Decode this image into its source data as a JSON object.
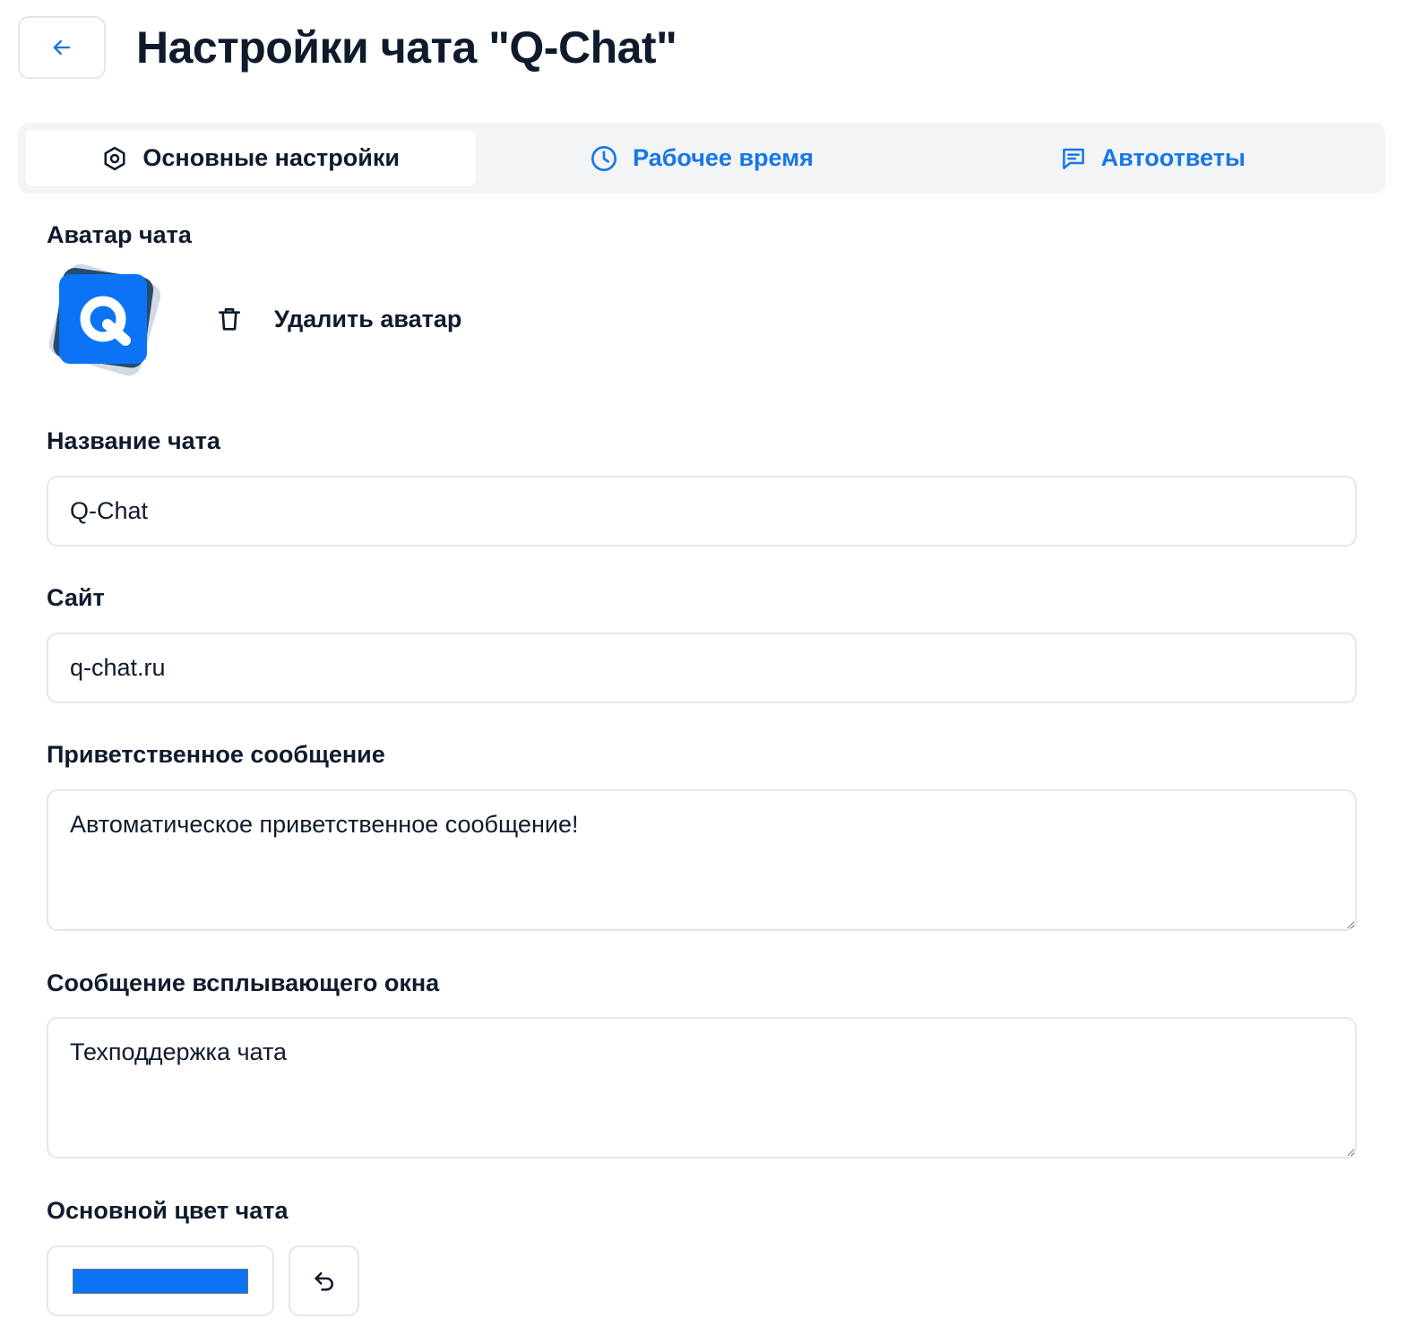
{
  "header": {
    "title": "Настройки чата \"Q-Chat\"",
    "back_icon": "arrow-left-icon"
  },
  "tabs": [
    {
      "label": "Основные настройки",
      "icon": "settings-hexagon-icon",
      "active": true
    },
    {
      "label": "Рабочее время",
      "icon": "clock-icon",
      "active": false
    },
    {
      "label": "Автоответы",
      "icon": "message-lines-icon",
      "active": false
    }
  ],
  "avatar": {
    "label": "Аватар чата",
    "delete_label": "Удалить аватар",
    "delete_icon": "trash-icon",
    "logo_letter": "Q"
  },
  "form": {
    "chat_name": {
      "label": "Название чата",
      "value": "Q-Chat"
    },
    "site": {
      "label": "Сайт",
      "value": "q-chat.ru"
    },
    "welcome_message": {
      "label": "Приветственное сообщение",
      "value": "Автоматическое приветственное сообщение!"
    },
    "popup_message": {
      "label": "Сообщение всплывающего окна",
      "value": "Техподдержка чата"
    },
    "main_color": {
      "label": "Основной цвет чата",
      "value": "#0a74f5",
      "reset_icon": "undo-icon"
    }
  },
  "colors": {
    "accent": "#1677e8",
    "text": "#0f1b2d",
    "border": "#e3e6ea",
    "tabs_bg": "#f3f4f6"
  }
}
